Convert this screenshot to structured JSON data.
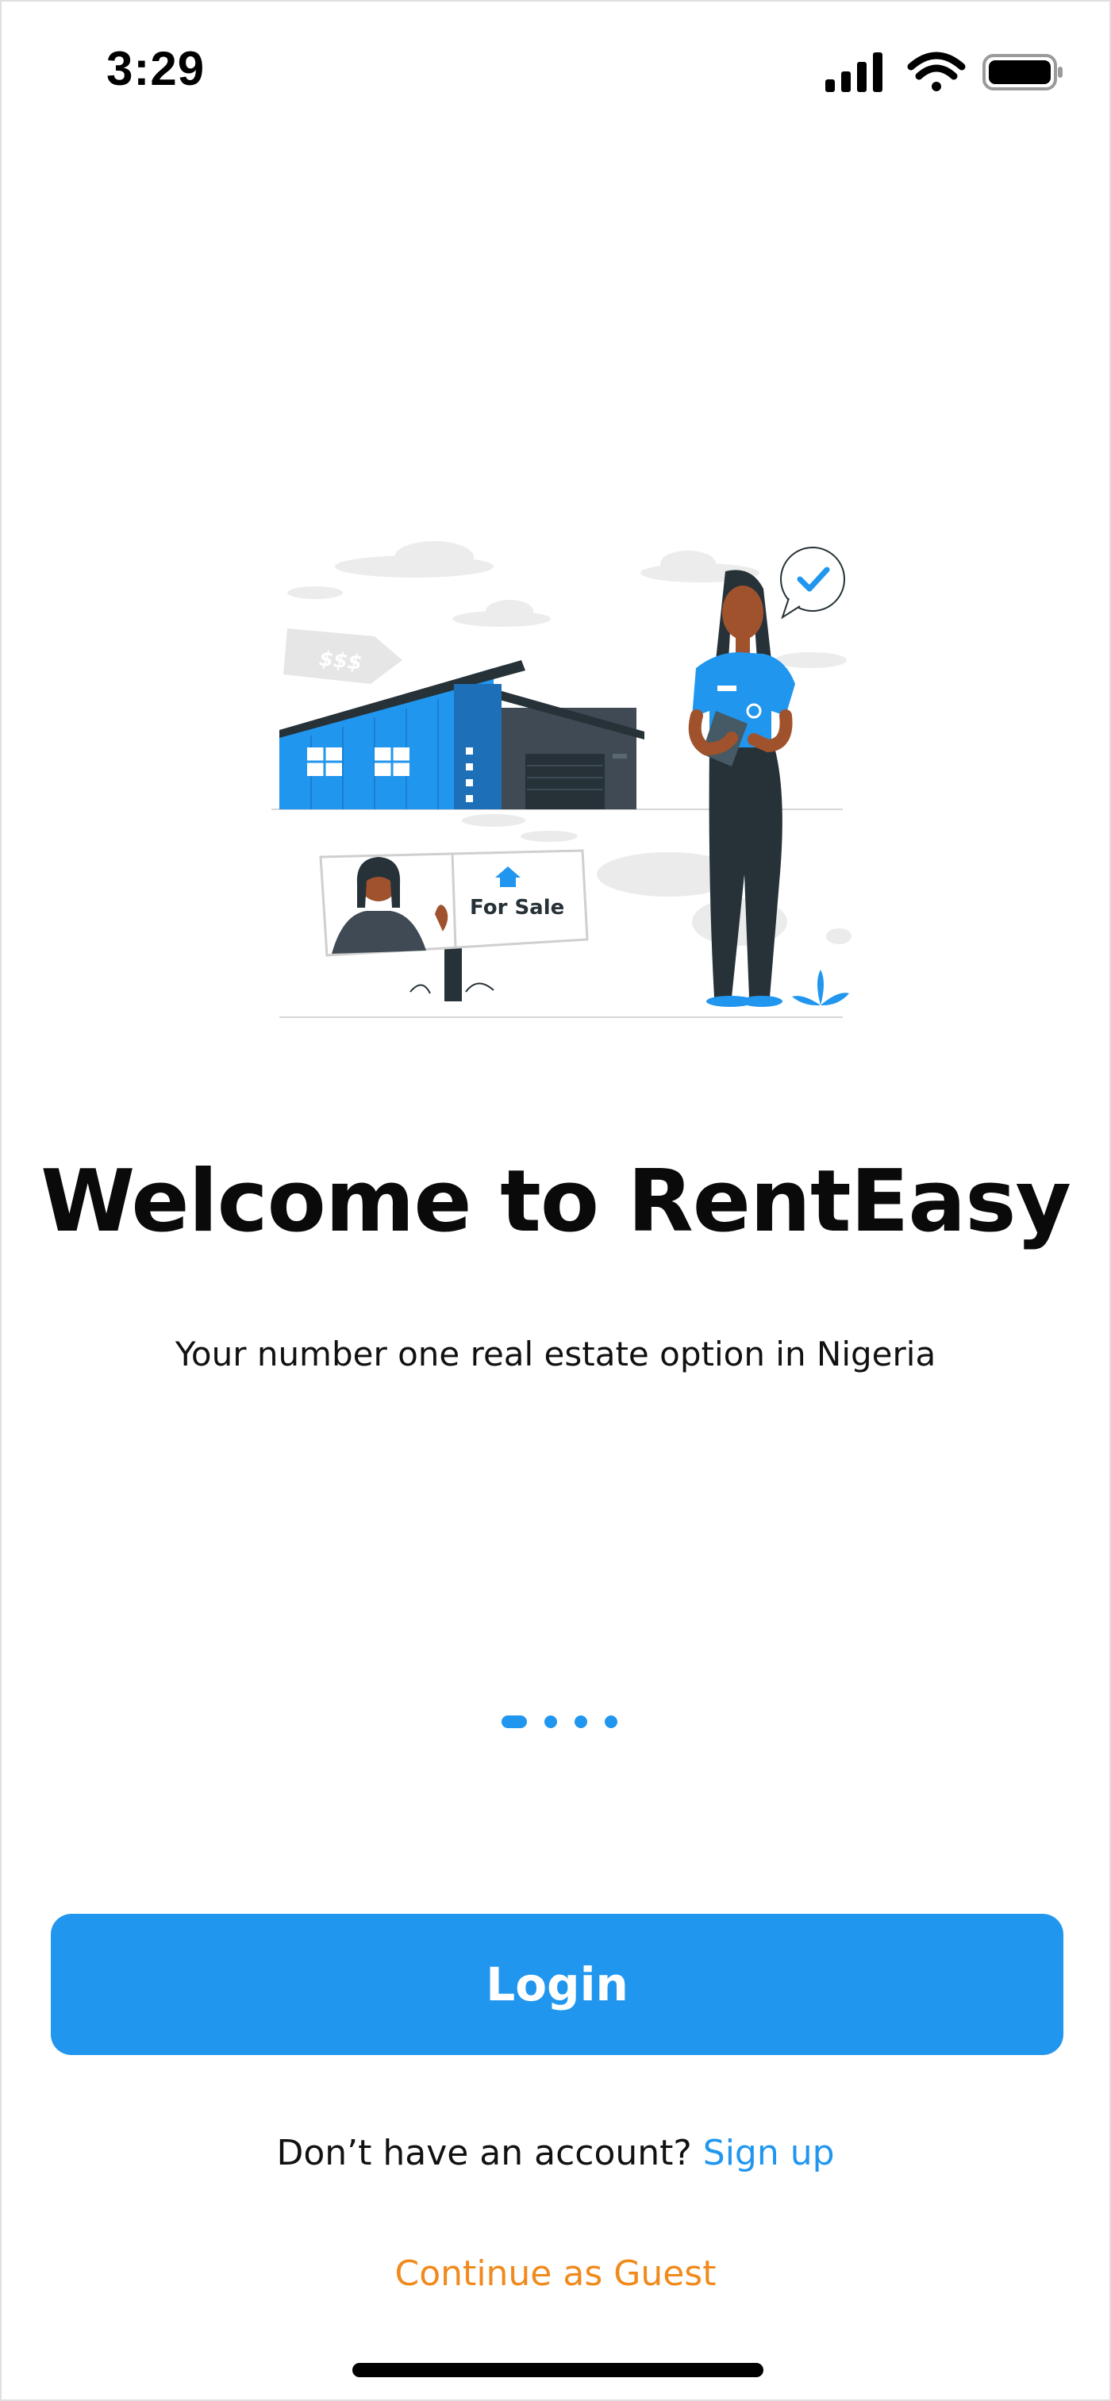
{
  "status_bar": {
    "time": "3:29",
    "icons": [
      "cellular-signal-icon",
      "wifi-icon",
      "battery-icon"
    ]
  },
  "illustration": {
    "price_tag_text": "$$$",
    "sign_text": "For Sale"
  },
  "onboarding": {
    "title": "Welcome to RentEasy",
    "subtitle": "Your number one real estate option in Nigeria",
    "page_indicator": {
      "total": 4,
      "active_index": 0
    }
  },
  "actions": {
    "login_label": "Login",
    "signup_prompt": "Don’t have an account?",
    "signup_label": "Sign up",
    "guest_label": "Continue as Guest"
  },
  "colors": {
    "accent": "#2196ef",
    "guest_link": "#f08a1c",
    "text": "#111111",
    "background": "#ffffff"
  }
}
